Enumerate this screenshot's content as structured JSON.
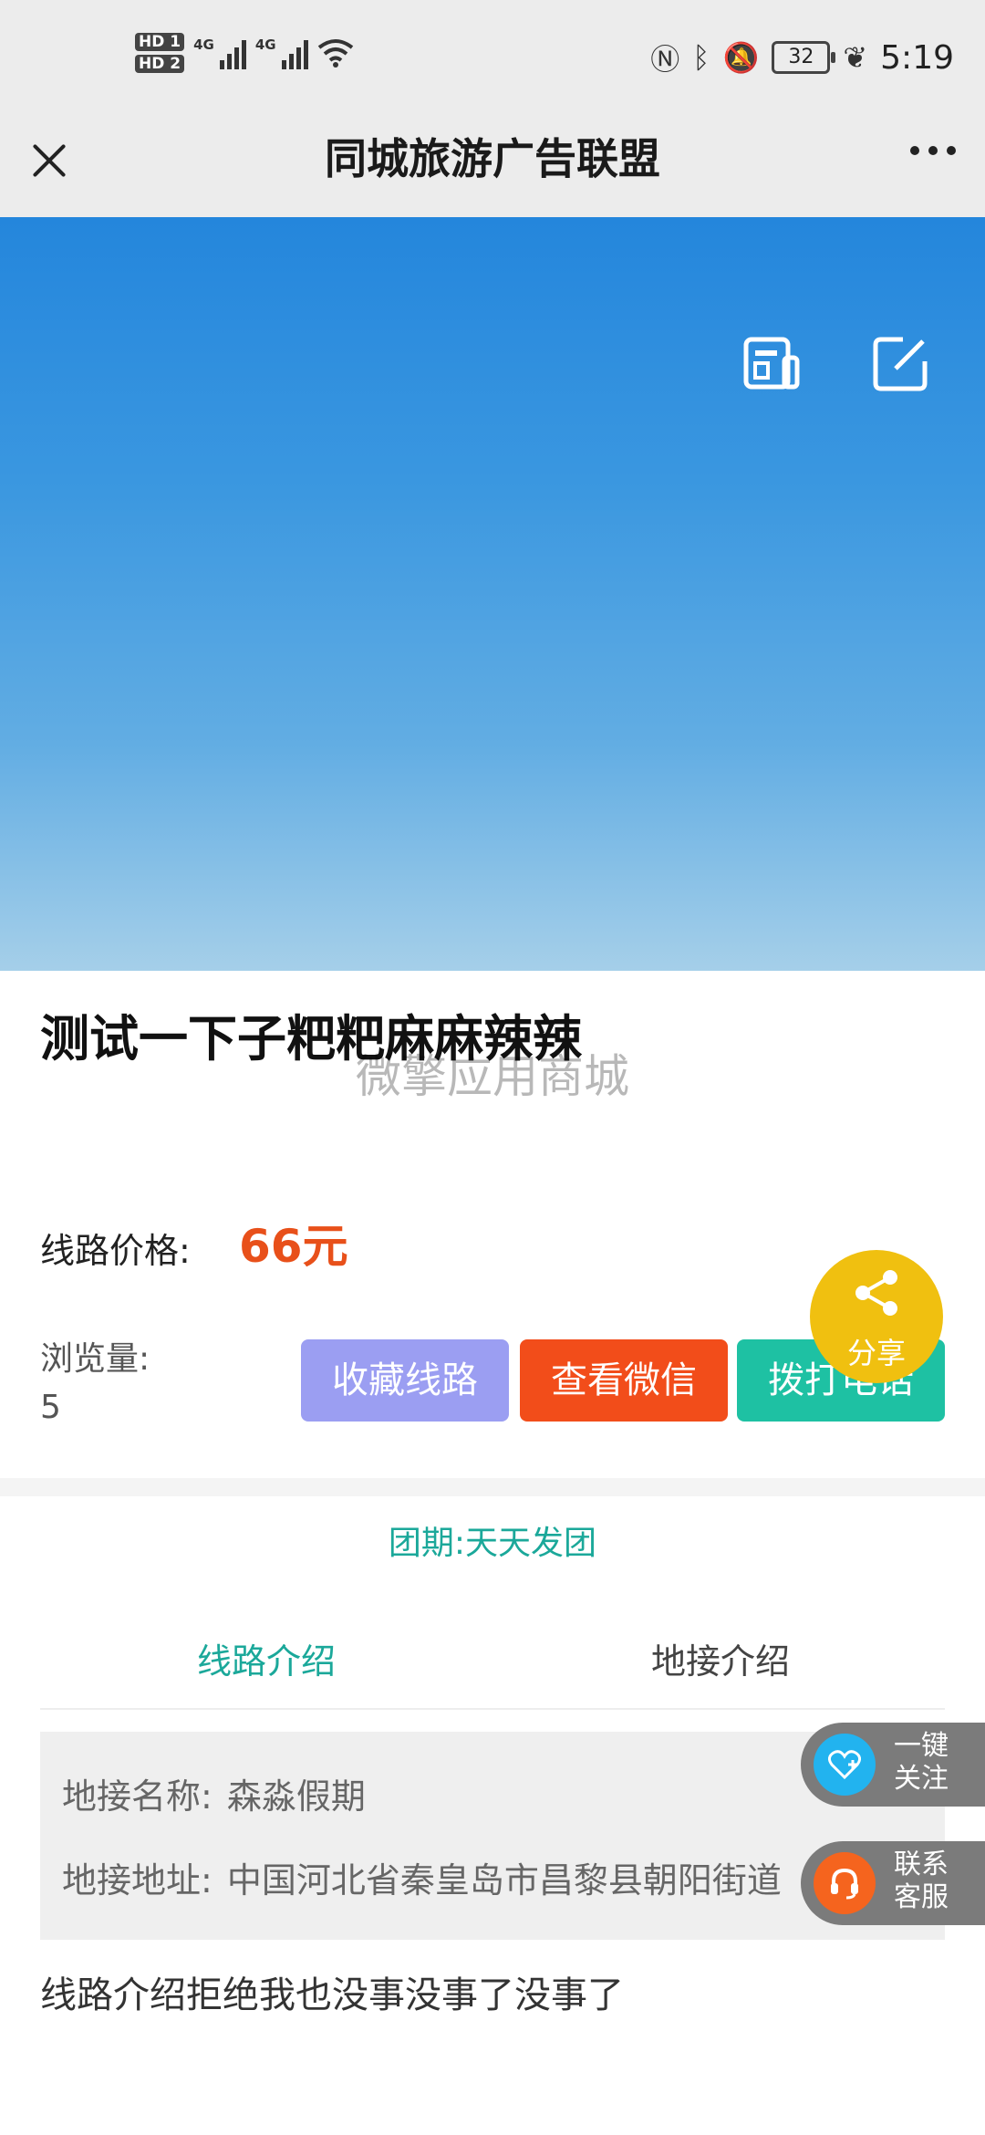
{
  "status_bar": {
    "sim1": "HD 1",
    "sim2": "HD 2",
    "net1": "4G",
    "net2": "4G",
    "battery": "32",
    "time": "5:19"
  },
  "header": {
    "title": "同城旅游广告联盟"
  },
  "route": {
    "title": "测试一下子粑粑麻麻辣辣",
    "watermark": "微擎应用商城",
    "price_label": "线路价格:",
    "price_value": "66元",
    "views_label": "浏览量:",
    "views_value": "5"
  },
  "actions": {
    "favorite": "收藏线路",
    "wechat": "查看微信",
    "call": "拨打电话",
    "share": "分享"
  },
  "group_date": "团期:天天发团",
  "tabs": [
    {
      "label": "线路介绍",
      "active": true
    },
    {
      "label": "地接介绍",
      "active": false
    }
  ],
  "agency": {
    "name_label": "地接名称:",
    "name_value": "森淼假期",
    "address_label": "地接地址:",
    "address_value": "中国河北省秦皇岛市昌黎县朝阳街道"
  },
  "description": "线路介绍拒绝我也没事没事了没事了",
  "floating": {
    "follow_line1": "一键",
    "follow_line2": "关注",
    "service_line1": "联系",
    "service_line2": "客服"
  },
  "colors": {
    "accent_teal": "#1ba89a",
    "price_orange": "#e8501a",
    "favorite_btn": "#9b9ef2",
    "wechat_btn": "#f24d1a",
    "call_btn": "#1ec1a3",
    "share_btn": "#f0c010"
  }
}
